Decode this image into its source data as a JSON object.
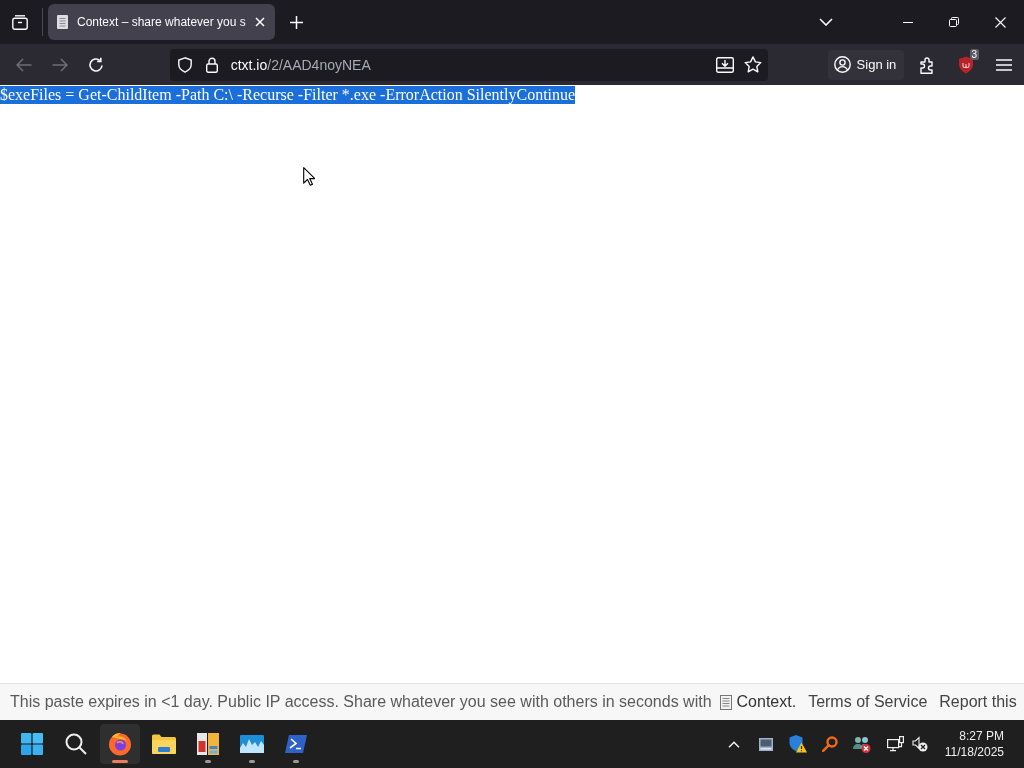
{
  "browser": {
    "tabs": [
      {
        "title": "Context – share whatever you s",
        "selected": true
      }
    ],
    "navigation": {
      "back_disabled": true,
      "forward_disabled": true
    },
    "address_bar": {
      "host": "ctxt.io",
      "path": "/2/AAD4noyNEA"
    },
    "account": {
      "label": "Sign in"
    },
    "extension_badge": "3"
  },
  "page": {
    "lines": [
      {
        "text": "$exeFiles = Get-ChildItem -Path C:\\ -Recurse -Filter *.exe -ErrorAction SilentlyContinue",
        "selected": true
      }
    ]
  },
  "footer": {
    "notice": "This paste expires in <1 day. Public IP access. Share whatever you see with others in seconds with",
    "brand_link": "Context.",
    "links": [
      "Terms of Service",
      "Report this"
    ]
  },
  "taskbar": {
    "apps": [
      {
        "kind": "start",
        "open": false,
        "active": false
      },
      {
        "kind": "search",
        "open": false,
        "active": false
      },
      {
        "kind": "browser",
        "open": true,
        "active": true
      },
      {
        "kind": "folder",
        "open": false,
        "active": false
      },
      {
        "kind": "panels",
        "open": true,
        "active": false
      },
      {
        "kind": "chart",
        "open": true,
        "active": false
      },
      {
        "kind": "terminal",
        "open": true,
        "active": false
      }
    ],
    "clock": {
      "time": "8:27 PM",
      "date": "11/18/2025"
    }
  }
}
